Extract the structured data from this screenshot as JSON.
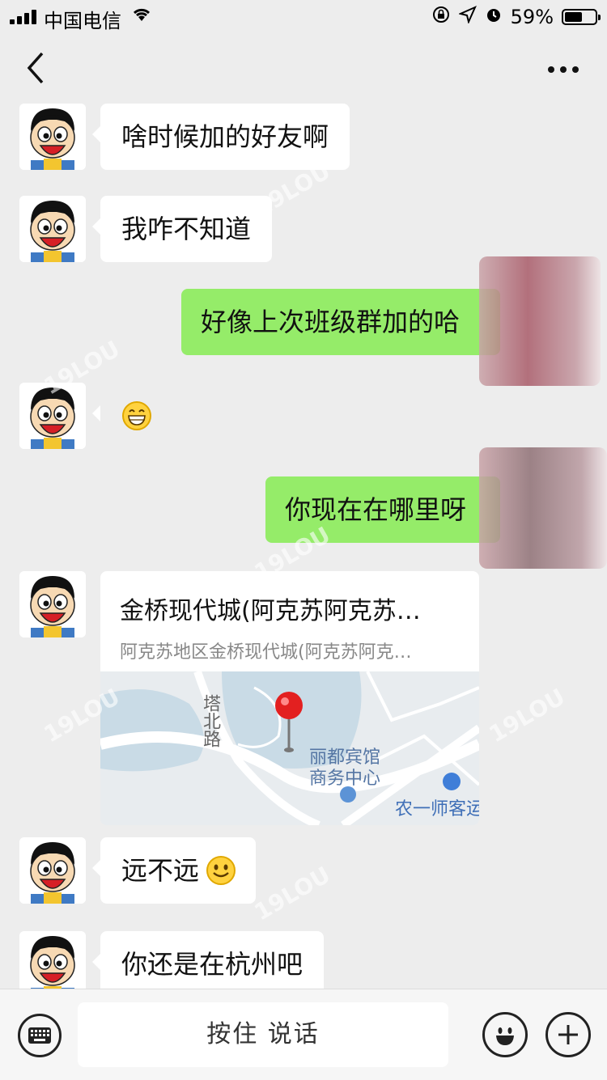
{
  "status_bar": {
    "carrier": "中国电信",
    "battery_percent": "59%",
    "battery_level": 0.59
  },
  "nav": {
    "back_icon": "chevron-left-icon",
    "more_icon": "more-dots-icon"
  },
  "messages": [
    {
      "side": "left",
      "type": "text",
      "text": "啥时候加的好友啊"
    },
    {
      "side": "left",
      "type": "text",
      "text": "我咋不知道"
    },
    {
      "side": "right",
      "type": "text",
      "text": "好像上次班级群加的哈"
    },
    {
      "side": "left",
      "type": "emoji",
      "icon": "grin-emoji-icon"
    },
    {
      "side": "right",
      "type": "text",
      "text": "你现在在哪里呀"
    },
    {
      "side": "left",
      "type": "location",
      "title": "金桥现代城(阿克苏阿克苏…",
      "subtitle": "阿克苏地区金桥现代城(阿克苏阿克…",
      "map_labels": {
        "road": "塔北路",
        "hotel_line1": "丽都宾馆",
        "hotel_line2": "商务中心",
        "station": "农一师客运"
      }
    },
    {
      "side": "left",
      "type": "text",
      "text": "远不远",
      "icon": "smile-emoji-icon"
    },
    {
      "side": "left",
      "type": "text",
      "text": "你还是在杭州吧"
    }
  ],
  "input_bar": {
    "hold_to_talk_label": "按住 说话",
    "keyboard_icon": "keyboard-icon",
    "emoji_icon": "emoji-face-icon",
    "plus_icon": "plus-icon"
  },
  "watermark": "19LOU",
  "colors": {
    "background": "#ededed",
    "sent_bubble": "#95ec69",
    "received_bubble": "#ffffff"
  }
}
